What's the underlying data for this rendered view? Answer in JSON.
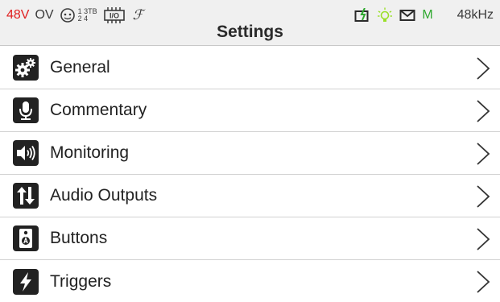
{
  "status_bar": {
    "phantom_power": "48V",
    "overview": "OV",
    "xlr_top": "1 3TB",
    "xlr_bottom": "2 4",
    "dsp_label": "I/O",
    "font_glyph": "ℱ",
    "monitor_mode": "M",
    "sample_rate": "48kHz"
  },
  "title": "Settings",
  "menu": [
    {
      "label": "General",
      "icon": "gears-icon"
    },
    {
      "label": "Commentary",
      "icon": "microphone-icon"
    },
    {
      "label": "Monitoring",
      "icon": "speaker-icon"
    },
    {
      "label": "Audio Outputs",
      "icon": "arrows-up-down-icon"
    },
    {
      "label": "Buttons",
      "icon": "button-panel-icon"
    },
    {
      "label": "Triggers",
      "icon": "lightning-icon"
    }
  ],
  "colors": {
    "phantom_power": "#e02020",
    "monitor_mode": "#2fa82f",
    "status_bg": "#f0f0f0",
    "icon_bg": "#222222"
  }
}
